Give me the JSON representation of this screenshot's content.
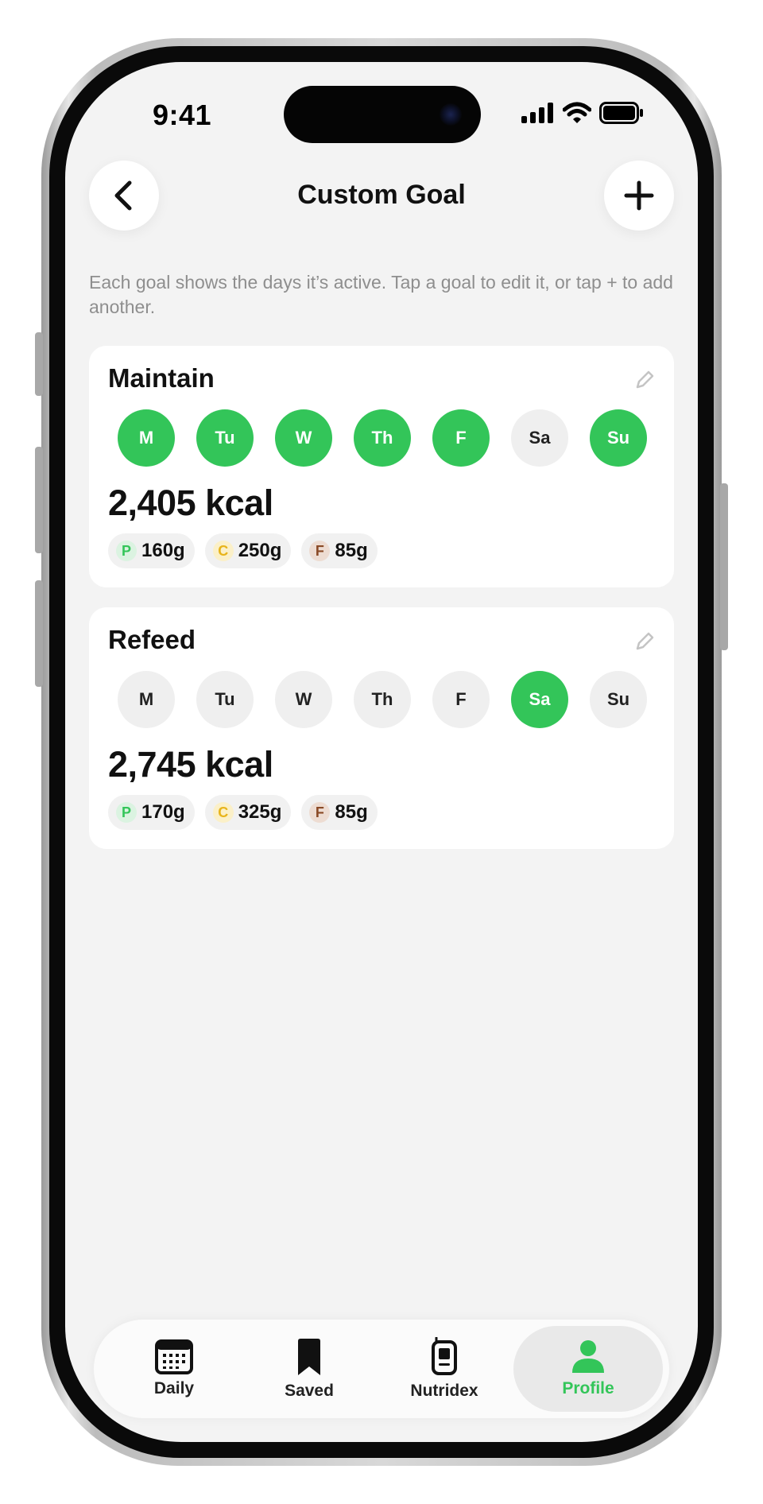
{
  "status_bar": {
    "time": "9:41"
  },
  "header": {
    "title": "Custom Goal",
    "back_icon": "chevron-left-icon",
    "add_icon": "plus-icon"
  },
  "subtitle": "Each goal shows the days it’s active. Tap a goal to edit it, or tap + to add another.",
  "colors": {
    "accent": "#33c559",
    "inactive_day": "#efefef",
    "background": "#f3f3f3"
  },
  "goals": [
    {
      "name": "Maintain",
      "days": [
        {
          "label": "M",
          "active": true
        },
        {
          "label": "Tu",
          "active": true
        },
        {
          "label": "W",
          "active": true
        },
        {
          "label": "Th",
          "active": true
        },
        {
          "label": "F",
          "active": true
        },
        {
          "label": "Sa",
          "active": false
        },
        {
          "label": "Su",
          "active": true
        }
      ],
      "kcal": "2,405 kcal",
      "macros": [
        {
          "letter": "P",
          "value": "160g"
        },
        {
          "letter": "C",
          "value": "250g"
        },
        {
          "letter": "F",
          "value": "85g"
        }
      ]
    },
    {
      "name": "Refeed",
      "days": [
        {
          "label": "M",
          "active": false
        },
        {
          "label": "Tu",
          "active": false
        },
        {
          "label": "W",
          "active": false
        },
        {
          "label": "Th",
          "active": false
        },
        {
          "label": "F",
          "active": false
        },
        {
          "label": "Sa",
          "active": true
        },
        {
          "label": "Su",
          "active": false
        }
      ],
      "kcal": "2,745 kcal",
      "macros": [
        {
          "letter": "P",
          "value": "170g"
        },
        {
          "letter": "C",
          "value": "325g"
        },
        {
          "letter": "F",
          "value": "85g"
        }
      ]
    }
  ],
  "tabbar": {
    "items": [
      {
        "label": "Daily",
        "icon": "calendar-icon",
        "active": false
      },
      {
        "label": "Saved",
        "icon": "bookmark-icon",
        "active": false
      },
      {
        "label": "Nutridex",
        "icon": "phone-device-icon",
        "active": false
      },
      {
        "label": "Profile",
        "icon": "person-icon",
        "active": true
      }
    ]
  }
}
